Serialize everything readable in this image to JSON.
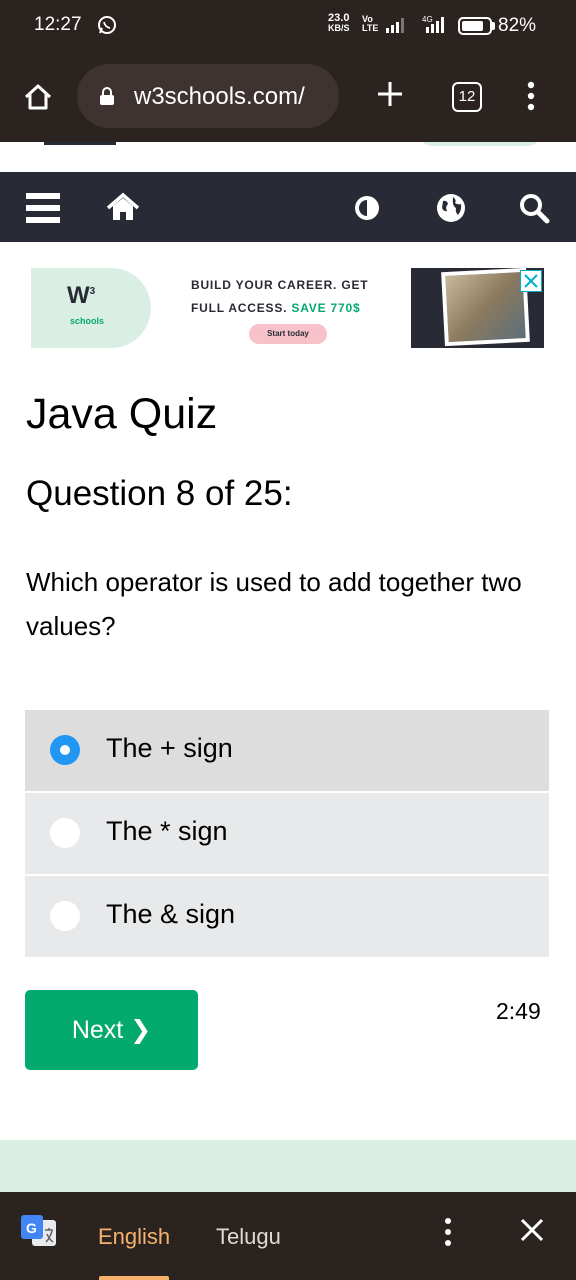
{
  "status_bar": {
    "time": "12:27",
    "net_speed_value": "23.0",
    "net_speed_unit": "KB/S",
    "volte_line1": "Vo",
    "volte_line2": "LTE",
    "network_label": "4G",
    "battery_percent": "82%",
    "battery_level": 0.82
  },
  "browser": {
    "url": "w3schools.com/",
    "tab_count": "12"
  },
  "ad": {
    "logo": "W",
    "logo_sup": "3",
    "logo_sub": "schools",
    "line1": "BUILD YOUR CAREER. GET",
    "line2_prefix": "FULL ACCESS.",
    "line2_highlight": "SAVE 770$",
    "cta": "Start today"
  },
  "quiz": {
    "title": "Java Quiz",
    "question_heading": "Question 8 of 25:",
    "question_text": "Which operator is used to add together two values?",
    "options": [
      {
        "label": "The + sign",
        "selected": true
      },
      {
        "label": "The * sign",
        "selected": false
      },
      {
        "label": "The & sign",
        "selected": false
      }
    ],
    "next_label": "Next ❯",
    "timer": "2:49"
  },
  "translate_bar": {
    "lang_source": "English",
    "lang_target": "Telugu"
  },
  "colors": {
    "w3_green": "#04aa6d",
    "nav_dark": "#282a35",
    "radio_blue": "#2196f3",
    "browser_chrome": "#2b2320",
    "active_lang": "#f6b26b"
  }
}
